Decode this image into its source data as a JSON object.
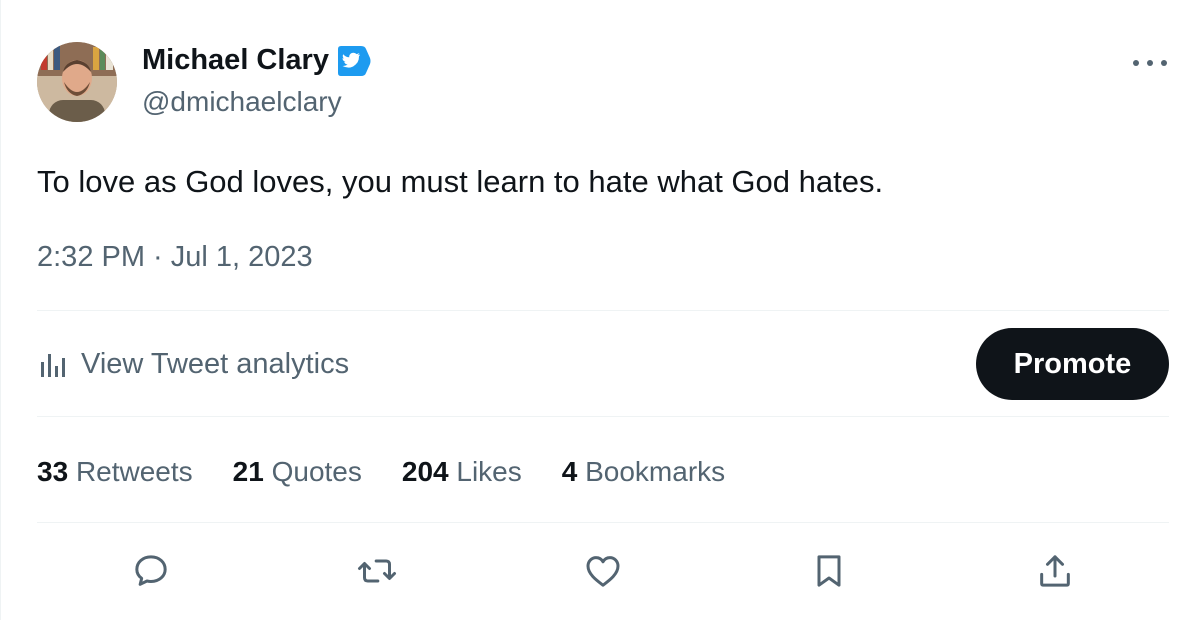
{
  "author": {
    "name": "Michael Clary",
    "handle": "@dmichaelclary",
    "verified_color": "#1d9bf0"
  },
  "tweet": {
    "text": "To love as God loves, you must learn to hate what God hates.",
    "timestamp": "2:32 PM · Jul 1, 2023"
  },
  "analytics": {
    "label": "View Tweet analytics",
    "icon": "bar-chart-icon"
  },
  "promote": {
    "label": "Promote"
  },
  "stats": [
    {
      "count": "33",
      "label": "Retweets"
    },
    {
      "count": "21",
      "label": "Quotes"
    },
    {
      "count": "204",
      "label": "Likes"
    },
    {
      "count": "4",
      "label": "Bookmarks"
    }
  ],
  "actions": [
    {
      "icon": "reply-icon"
    },
    {
      "icon": "retweet-icon"
    },
    {
      "icon": "like-icon"
    },
    {
      "icon": "bookmark-icon"
    },
    {
      "icon": "share-icon"
    }
  ],
  "colors": {
    "text_primary": "#0f1419",
    "text_secondary": "#536471",
    "divider": "#eff3f4",
    "promote_bg": "#0f1419"
  }
}
